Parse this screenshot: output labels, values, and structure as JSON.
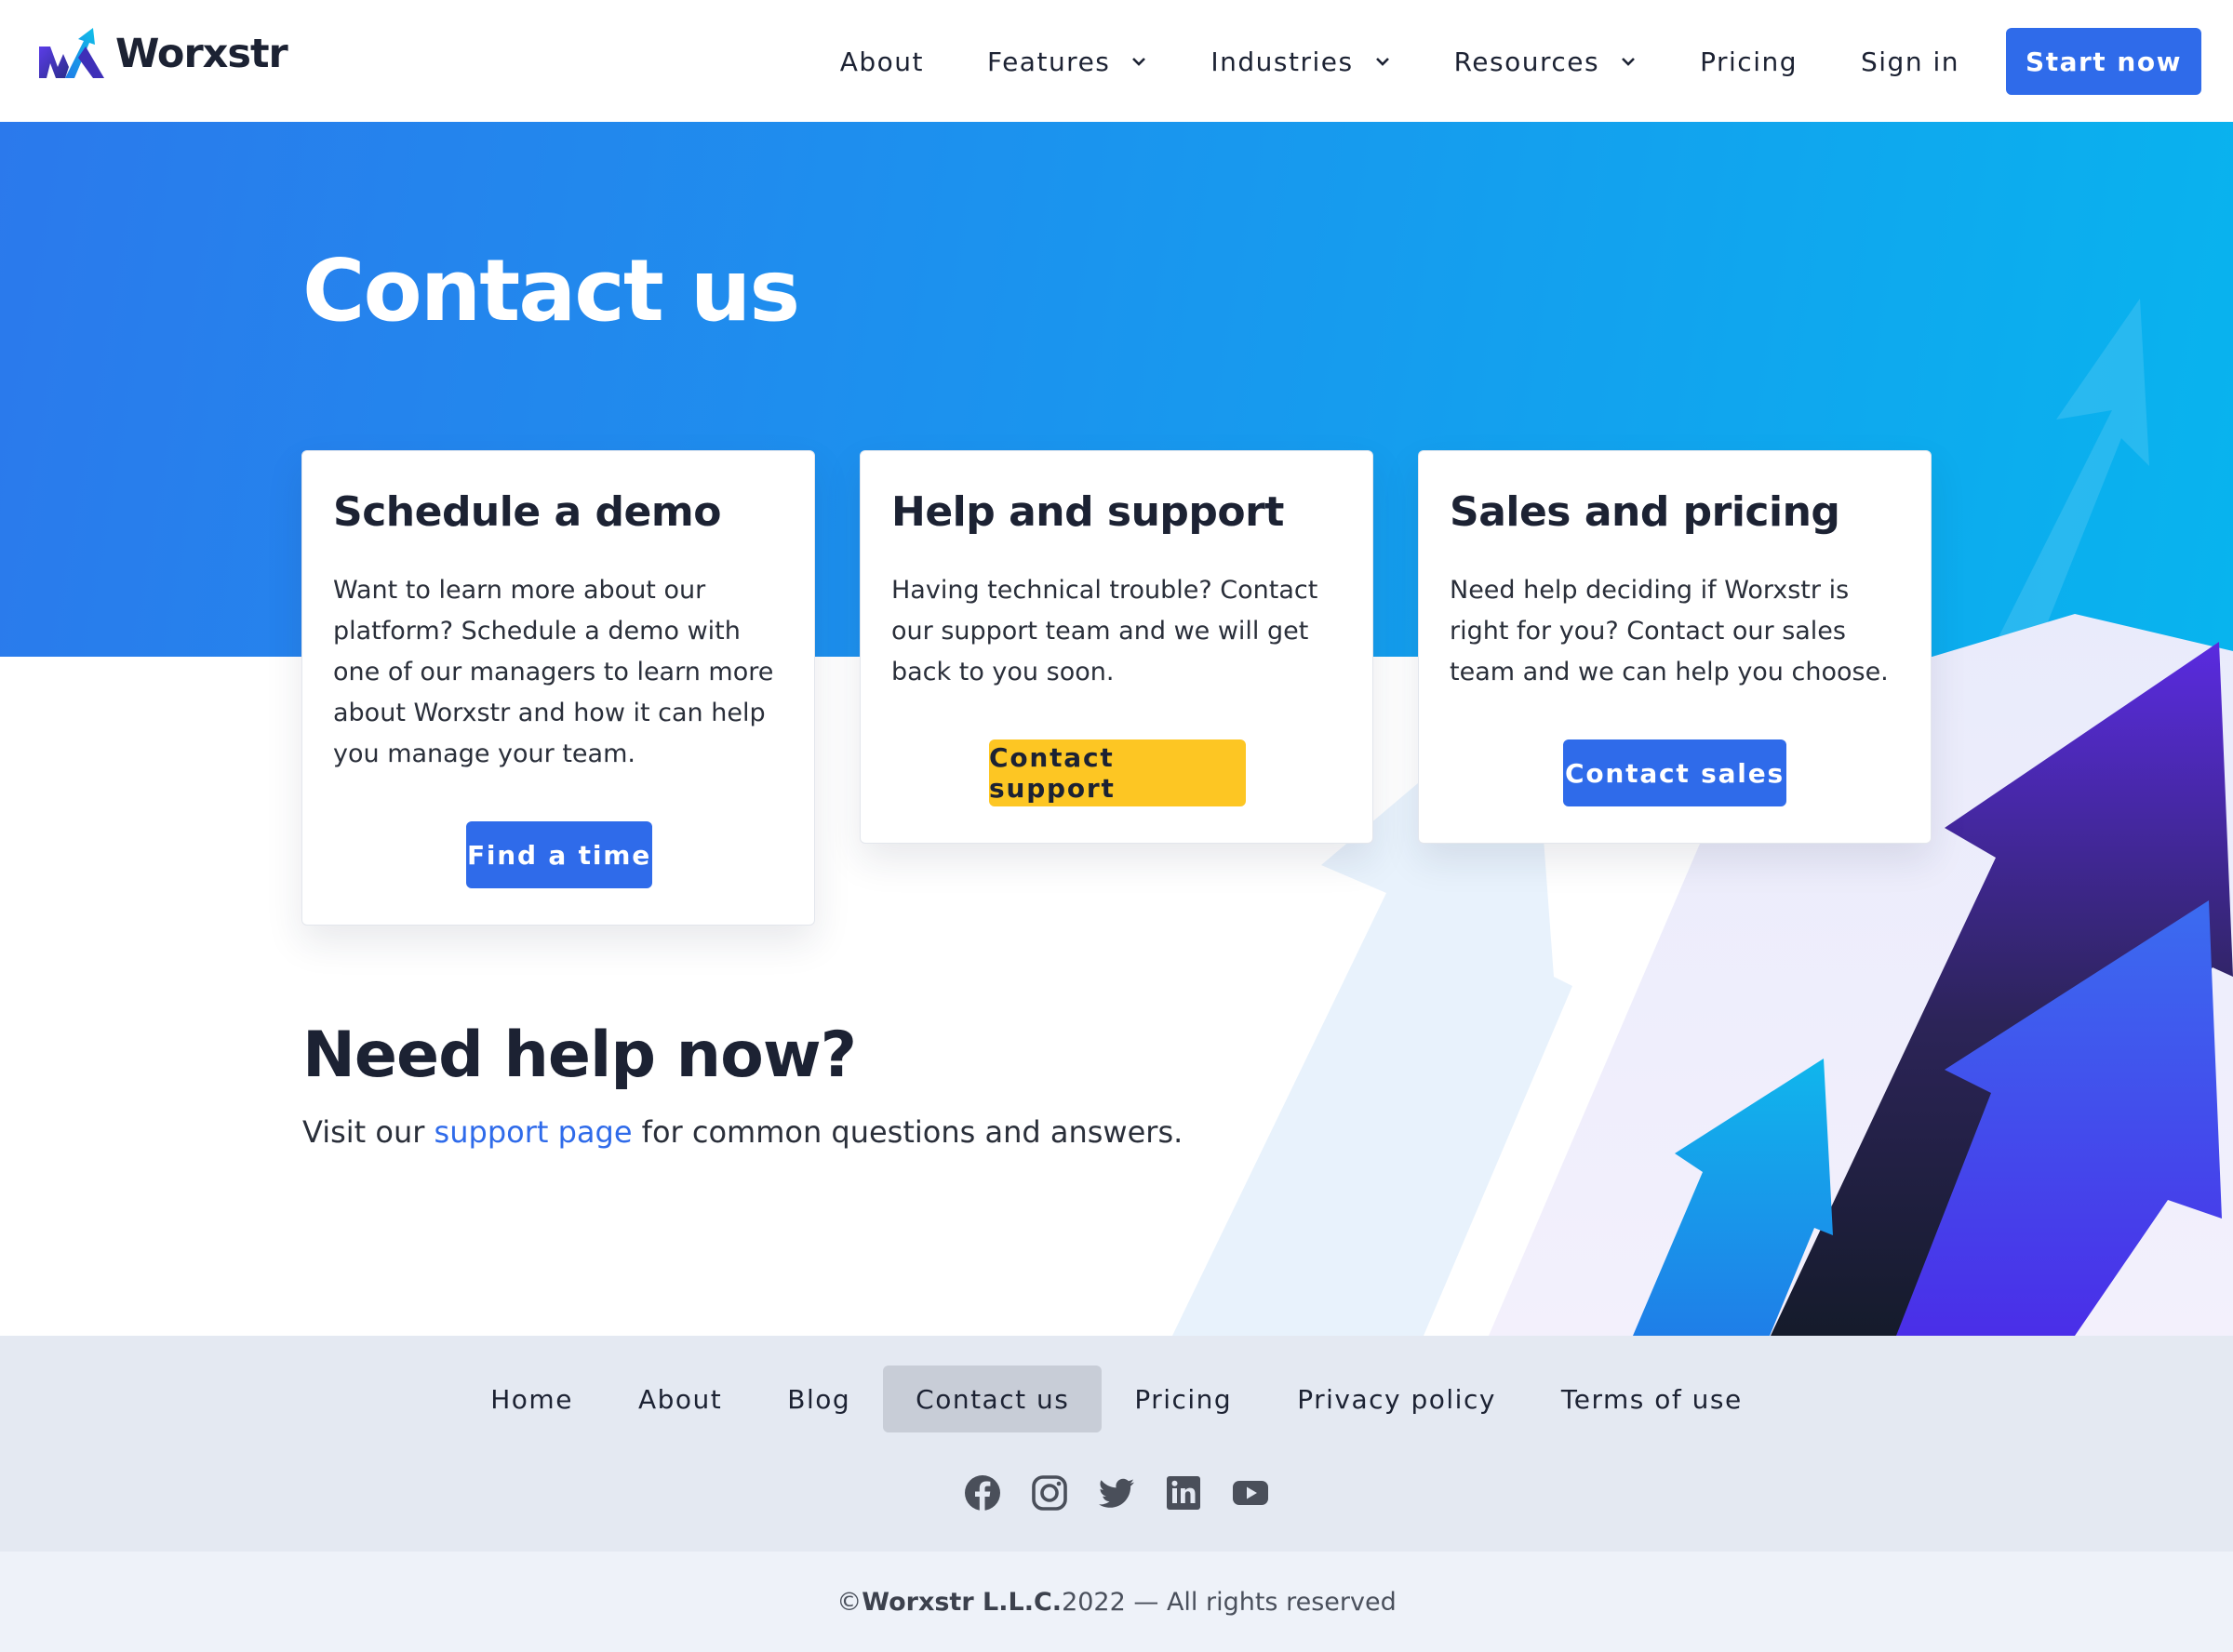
{
  "header": {
    "brand": "Worxstr",
    "nav": [
      {
        "label": "About"
      },
      {
        "label": "Features"
      },
      {
        "label": "Industries"
      },
      {
        "label": "Resources"
      },
      {
        "label": "Pricing"
      },
      {
        "label": "Sign in"
      }
    ],
    "cta": "Start now"
  },
  "hero": {
    "title": "Contact us"
  },
  "cards": [
    {
      "title": "Schedule a demo",
      "text": "Want to learn more about our platform? Schedule a demo with one of our managers to learn more about Worxstr and how it can help you manage your team.",
      "button": "Find a time"
    },
    {
      "title": "Help and support",
      "text": "Having technical trouble? Contact our support team and we will get back to you soon.",
      "button": "Contact support"
    },
    {
      "title": "Sales and pricing",
      "text": "Need help deciding if Worxstr is right for you? Contact our sales team and we can help you choose.",
      "button": "Contact sales"
    }
  ],
  "need_help": {
    "title": "Need help now?",
    "text_before": "Visit our ",
    "link": "support page",
    "text_after": " for common questions and answers."
  },
  "footer": {
    "nav": [
      {
        "label": "Home"
      },
      {
        "label": "About"
      },
      {
        "label": "Blog"
      },
      {
        "label": "Contact us",
        "active": true
      },
      {
        "label": "Pricing"
      },
      {
        "label": "Privacy policy"
      },
      {
        "label": "Terms of use"
      }
    ],
    "socials": [
      "facebook-icon",
      "instagram-icon",
      "twitter-icon",
      "linkedin-icon",
      "youtube-icon"
    ],
    "copyright_prefix": "© ",
    "copyright_company": "Worxstr L.L.C.",
    "copyright_suffix": " 2022 — All rights reserved"
  },
  "colors": {
    "primary": "#2f6bea",
    "accent_yellow": "#fdc623",
    "hero_start": "#2b79ec",
    "hero_end": "#08b4ee",
    "footer_bg": "#e4e9f2"
  }
}
